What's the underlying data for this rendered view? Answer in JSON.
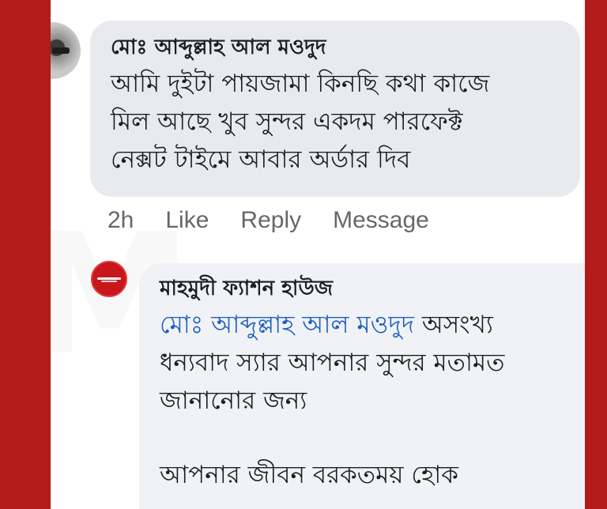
{
  "comment": {
    "author": "মোঃ আব্দুল্লাহ আল মওদুদ",
    "lines": [
      "আমি দুইটা পায়জামা কিনছি কথা কাজে",
      "মিল আছে খুব সুন্দর একদম পারফেক্ট",
      "নেক্সট টাইমে আবার অর্ডার দিব"
    ],
    "time": "2h",
    "like_label": "Like",
    "reply_label": "Reply",
    "message_label": "Message"
  },
  "reply": {
    "author": "মাহমুদী ফ্যাশন হাউজ",
    "mention": "মোঃ আব্দুল্লাহ আল মওদুদ",
    "line1_rest": " অসংখ্য",
    "line2": "ধন্যবাদ স্যার আপনার সুন্দর মতামত",
    "line3": "জানানোর জন্য",
    "line4": "আপনার জীবন বরকতময় হোক"
  },
  "colors": {
    "frame": "#b31b1b",
    "mention": "#1f5fbf",
    "bubble": "#e9eaee"
  }
}
